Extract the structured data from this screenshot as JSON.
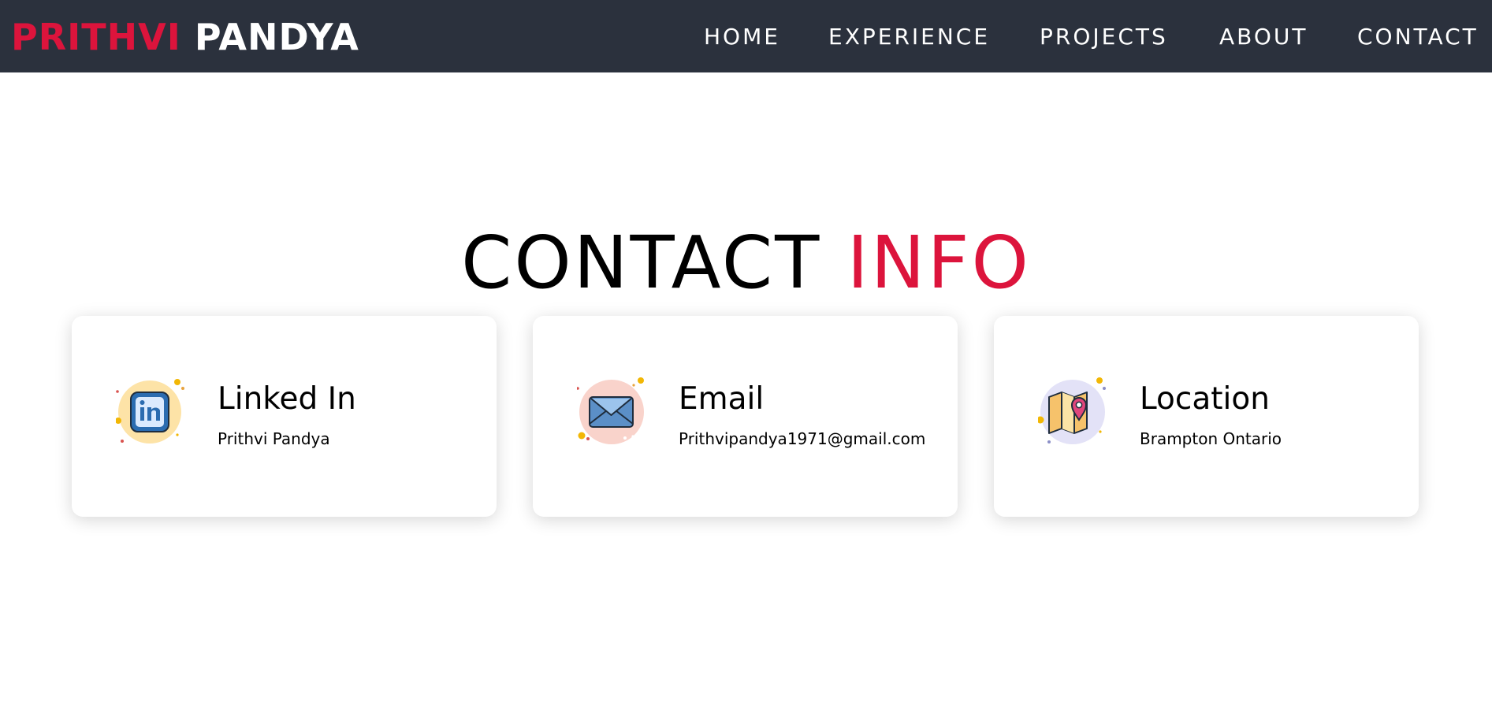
{
  "header": {
    "logo_first": "PRITHVI",
    "logo_last": "PANDYA",
    "nav": [
      "HOME",
      "EXPERIENCE",
      "PROJECTS",
      "ABOUT",
      "CONTACT"
    ]
  },
  "main": {
    "title_main": "CONTACT",
    "title_accent": "INFO",
    "cards": [
      {
        "title": "Linked In",
        "value": "Prithvi Pandya",
        "icon": "linkedin-icon"
      },
      {
        "title": "Email",
        "value": "Prithvipandya1971@gmail.com",
        "icon": "envelope-icon"
      },
      {
        "title": "Location",
        "value": "Brampton Ontario",
        "icon": "map-pin-icon"
      }
    ]
  },
  "colors": {
    "navbar_bg": "#2b313d",
    "accent": "#dc143c",
    "nav_text": "#ffffff"
  }
}
